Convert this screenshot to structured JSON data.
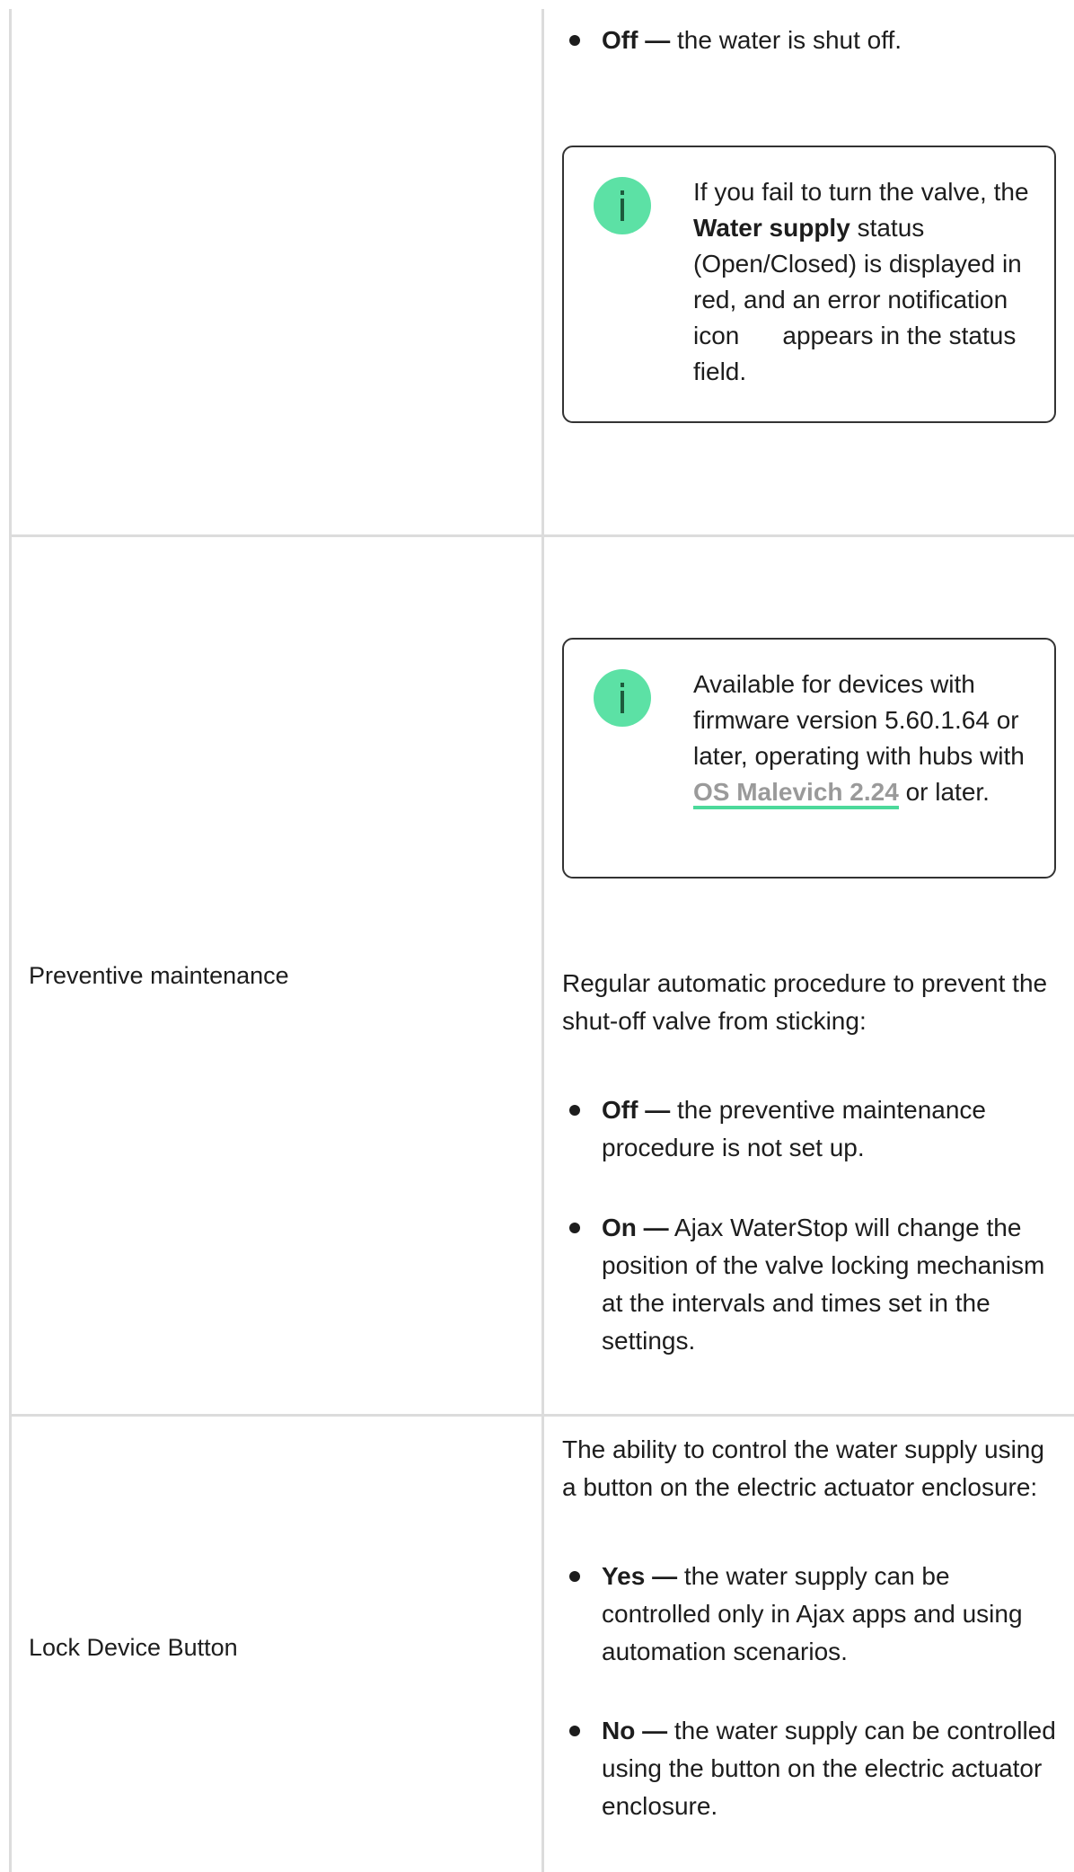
{
  "row1": {
    "bullet_off": {
      "term": "Off",
      "dash": "—",
      "text": "the water is shut off."
    },
    "note": {
      "line_pre": "If you fail to turn the valve, the",
      "bold": "Water supply",
      "line_mid": "status (Open/Closed) is displayed in red, and an error notification icon",
      "line_post": "appears in the status field."
    }
  },
  "row2": {
    "label": "Preventive maintenance",
    "note": {
      "text_pre": "Available for devices with firmware version 5.60.1.64 or later, operating with hubs with",
      "link": "OS Malevich 2.24",
      "text_post": "or later."
    },
    "description": "Regular automatic procedure to prevent the shut-off valve from sticking:",
    "bullet_off": {
      "term": "Off",
      "dash": "—",
      "text": "the preventive maintenance procedure is not set up."
    },
    "bullet_on": {
      "term": "On",
      "dash": "—",
      "text": "Ajax WaterStop will change the position of the valve locking mechanism at the intervals and times set in the settings."
    }
  },
  "row3": {
    "label": "Lock Device Button",
    "description": "The ability to control the water supply using a button on the electric actuator enclosure:",
    "bullet_yes": {
      "term": "Yes",
      "dash": "—",
      "text": "the water supply can be controlled only in Ajax apps and using automation scenarios."
    },
    "bullet_no": {
      "term": "No",
      "dash": "—",
      "text": "the water supply can be controlled using the button on the electric actuator enclosure."
    }
  },
  "colors": {
    "accent": "#5ce1a5",
    "link_underline": "#4cd99b",
    "border": "#dcdcdc"
  },
  "icons": [
    "info-icon",
    "error-notification-icon"
  ]
}
